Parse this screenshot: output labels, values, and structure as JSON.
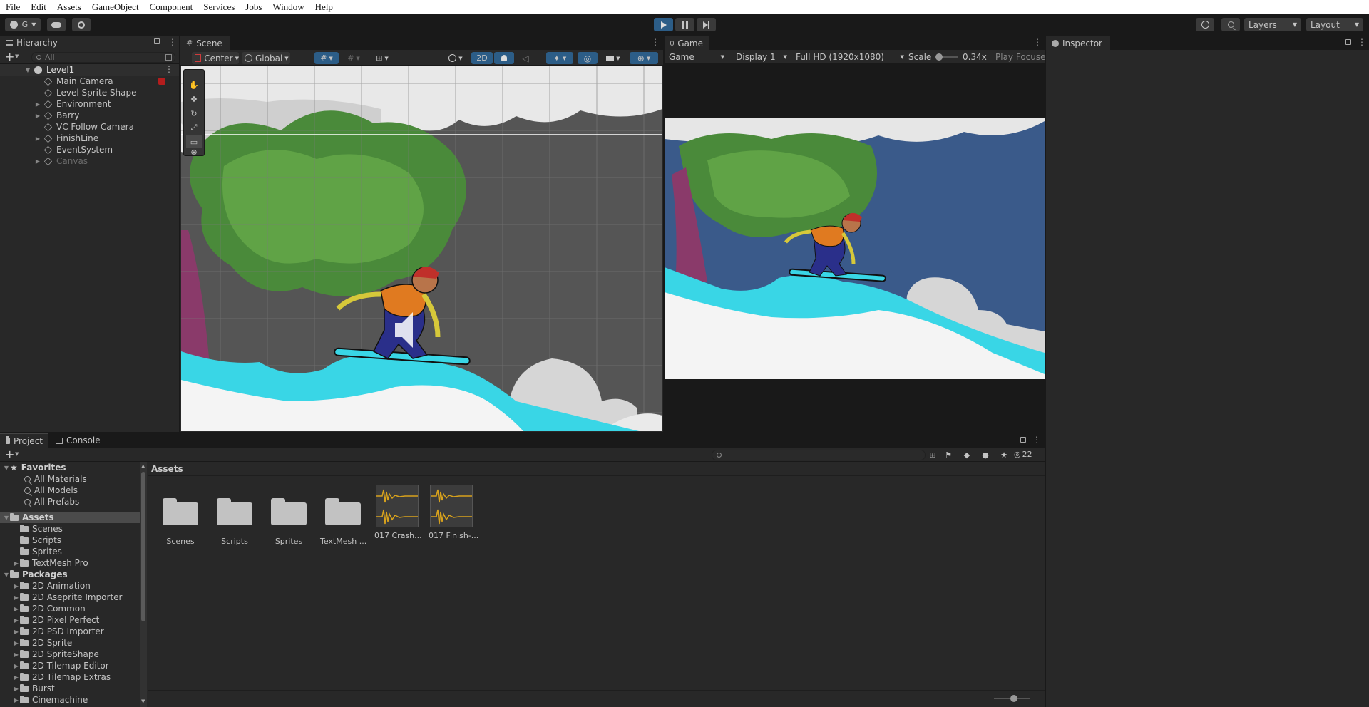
{
  "menu": [
    "File",
    "Edit",
    "Assets",
    "GameObject",
    "Component",
    "Services",
    "Jobs",
    "Window",
    "Help"
  ],
  "toolbar": {
    "account": "G",
    "play_icon": "play-icon",
    "pause_icon": "pause-icon",
    "step_icon": "step-icon",
    "layers": "Layers",
    "layout": "Layout"
  },
  "hierarchy": {
    "tab": "Hierarchy",
    "search_placeholder": "All",
    "scene": "Level1",
    "items": [
      {
        "label": "Main Camera",
        "expandable": false
      },
      {
        "label": "Level Sprite Shape",
        "expandable": false
      },
      {
        "label": "Environment",
        "expandable": true
      },
      {
        "label": "Barry",
        "expandable": true
      },
      {
        "label": "VC Follow Camera",
        "expandable": false
      },
      {
        "label": "FinishLine",
        "expandable": true
      },
      {
        "label": "EventSystem",
        "expandable": false
      },
      {
        "label": "Canvas",
        "expandable": true,
        "inactive": true
      }
    ]
  },
  "scene": {
    "tab": "Scene",
    "pivot": "Center",
    "space": "Global",
    "mode_2d": "2D"
  },
  "game": {
    "tab": "Game",
    "view": "Game",
    "display": "Display 1",
    "resolution": "Full HD (1920x1080)",
    "scale_label": "Scale",
    "scale_value": "0.34x",
    "play_focused": "Play Focused"
  },
  "inspector": {
    "tab": "Inspector"
  },
  "project": {
    "tab": "Project",
    "console_tab": "Console",
    "favorites": {
      "label": "Favorites",
      "items": [
        "All Materials",
        "All Models",
        "All Prefabs"
      ]
    },
    "assets": {
      "label": "Assets",
      "items": [
        "Scenes",
        "Scripts",
        "Sprites",
        "TextMesh Pro"
      ]
    },
    "packages": {
      "label": "Packages",
      "items": [
        "2D Animation",
        "2D Aseprite Importer",
        "2D Common",
        "2D Pixel Perfect",
        "2D PSD Importer",
        "2D Sprite",
        "2D SpriteShape",
        "2D Tilemap Editor",
        "2D Tilemap Extras",
        "Burst",
        "Cinemachine"
      ]
    },
    "breadcrumb": "Assets",
    "grid": [
      {
        "label": "Scenes",
        "kind": "folder"
      },
      {
        "label": "Scripts",
        "kind": "folder"
      },
      {
        "label": "Sprites",
        "kind": "folder"
      },
      {
        "label": "TextMesh ...",
        "kind": "folder"
      },
      {
        "label": "017 Crash...",
        "kind": "audio"
      },
      {
        "label": "017 Finish-...",
        "kind": "audio"
      }
    ],
    "hidden_count": "22"
  },
  "colors": {
    "accent": "#2c5d87",
    "sky": "#3a5a8a",
    "snow": "#39d6e6",
    "audio_wave": "#d8a21c"
  }
}
